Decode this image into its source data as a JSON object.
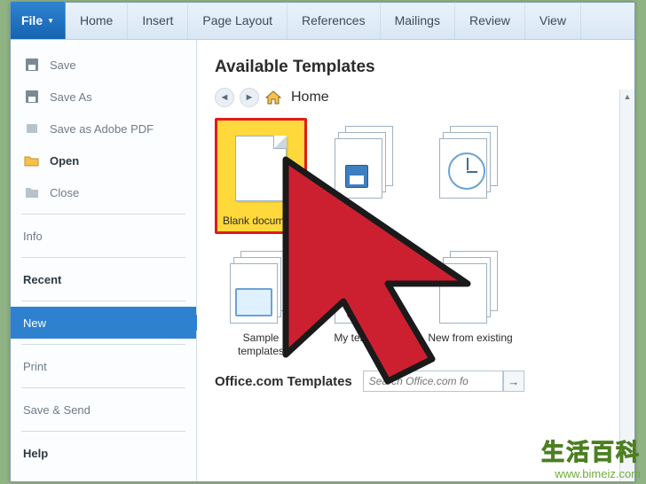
{
  "ribbon": {
    "file": "File",
    "tabs": [
      "Home",
      "Insert",
      "Page Layout",
      "References",
      "Mailings",
      "Review",
      "View"
    ]
  },
  "side": {
    "save": "Save",
    "save_as": "Save As",
    "save_pdf": "Save as Adobe PDF",
    "open": "Open",
    "close": "Close",
    "info": "Info",
    "recent": "Recent",
    "new": "New",
    "print": "Print",
    "save_send": "Save & Send",
    "help": "Help"
  },
  "content": {
    "header": "Available Templates",
    "nav_home": "Home",
    "tiles": {
      "blank": "Blank document",
      "sample": "Sample templates",
      "mytpl": "My templates",
      "newfrom": "New from existing"
    },
    "officecom": "Office.com Templates",
    "search_placeholder": "Search Office.com fo",
    "search_go": "→"
  },
  "watermark": {
    "cn": "生活百科",
    "url": "www.bimeiz.com"
  }
}
